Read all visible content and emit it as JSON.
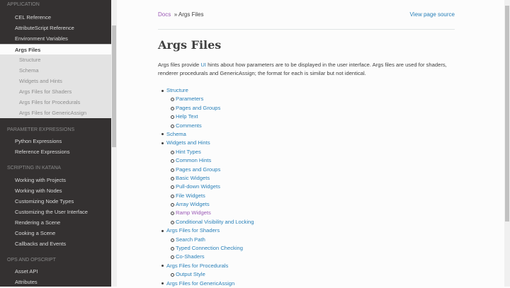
{
  "sidebar": {
    "sections": [
      {
        "caption": "APPLICATION",
        "items": [
          "CEL Reference",
          "AttributeScript Reference",
          "Environment Variables",
          "Args Files"
        ]
      },
      {
        "caption": "PARAMETER EXPRESSIONS",
        "items": [
          "Python Expressions",
          "Reference Expressions"
        ]
      },
      {
        "caption": "SCRIPTING IN KATANA",
        "items": [
          "Working with Projects",
          "Working with Nodes",
          "Customizing Node Types",
          "Customizing the User Interface",
          "Rendering a Scene",
          "Cooking a Scene",
          "Callbacks and Events"
        ]
      },
      {
        "caption": "OPS AND OPSCRIPT",
        "items": [
          "Asset API",
          "Attributes"
        ]
      }
    ],
    "current_sub": [
      "Structure",
      "Schema",
      "Widgets and Hints",
      "Args Files for Shaders",
      "Args Files for Procedurals",
      "Args Files for GenericAssign"
    ]
  },
  "breadcrumb": {
    "docs": "Docs",
    "sep": "»",
    "current": "Args Files",
    "source": "View page source"
  },
  "title": "Args Files",
  "intro": {
    "a": "Args files provide ",
    "ui": "UI",
    "b": " hints about how parameters are to be displayed in the user interface. Args files are used for shaders, renderer procedurals and GenericAssign; the format for each is similar but not identical."
  },
  "toc": [
    {
      "t": "Structure",
      "l": 1
    },
    {
      "t": "Parameters",
      "l": 2
    },
    {
      "t": "Pages and Groups",
      "l": 2
    },
    {
      "t": "Help Text",
      "l": 2
    },
    {
      "t": "Comments",
      "l": 2
    },
    {
      "t": "Schema",
      "l": 1
    },
    {
      "t": "Widgets and Hints",
      "l": 1
    },
    {
      "t": "Hint Types",
      "l": 2
    },
    {
      "t": "Common Hints",
      "l": 2
    },
    {
      "t": "Pages and Groups",
      "l": 2
    },
    {
      "t": "Basic Widgets",
      "l": 2
    },
    {
      "t": "Pull-down Widgets",
      "l": 2
    },
    {
      "t": "File Widgets",
      "l": 2
    },
    {
      "t": "Array Widgets",
      "l": 2
    },
    {
      "t": "Ramp Widgets",
      "l": 2,
      "visited": true
    },
    {
      "t": "Conditional Visibility and Locking",
      "l": 2
    },
    {
      "t": "Args Files for Shaders",
      "l": 1
    },
    {
      "t": "Search Path",
      "l": 2
    },
    {
      "t": "Typed Connection Checking",
      "l": 2
    },
    {
      "t": "Co-Shaders",
      "l": 2
    },
    {
      "t": "Args Files for Procedurals",
      "l": 1
    },
    {
      "t": "Output Style",
      "l": 2
    },
    {
      "t": "Args Files for GenericAssign",
      "l": 1
    }
  ]
}
